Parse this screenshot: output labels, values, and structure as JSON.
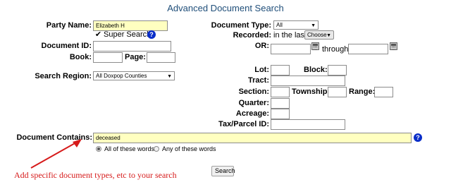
{
  "page": {
    "title": "Advanced Document Search"
  },
  "left_form": {
    "party_name_label": "Party Name:",
    "party_name_value": "Elizabeth H",
    "super_search_label": "Super Search",
    "document_id_label": "Document ID:",
    "document_id_value": "",
    "book_label": "Book:",
    "book_value": "",
    "page_label": "Page:",
    "page_value": "",
    "search_region_label": "Search Region:",
    "search_region_value": "All Doxpop Counties"
  },
  "right_form": {
    "document_type_label": "Document Type:",
    "document_type_value": "All",
    "recorded_label": "Recorded:",
    "recorded_text": "in the last",
    "recorded_choose": "Choose",
    "or_label": "OR:",
    "through_text": "through",
    "lot_label": "Lot:",
    "block_label": "Block:",
    "tract_label": "Tract:",
    "section_label": "Section:",
    "township_label": "Township:",
    "range_label": "Range:",
    "quarter_label": "Quarter:",
    "acreage_label": "Acreage:",
    "tax_parcel_label": "Tax/Parcel ID:"
  },
  "contains": {
    "label": "Document Contains:",
    "value": "deceased",
    "option_all": "All of these words",
    "option_any": "Any of these words"
  },
  "actions": {
    "search_button": "Search"
  },
  "annotation": {
    "text": "Add specific document types, etc to your search",
    "color": "#d61a1a"
  },
  "colors": {
    "title": "#1f4e79",
    "highlight_field": "#ffffc0",
    "help_icon": "#0a2ec9"
  },
  "icons": {
    "help": "help-icon",
    "calendar": "calendar-icon",
    "checkbox": "checkbox-checked-icon",
    "arrow": "red-arrow-icon"
  }
}
